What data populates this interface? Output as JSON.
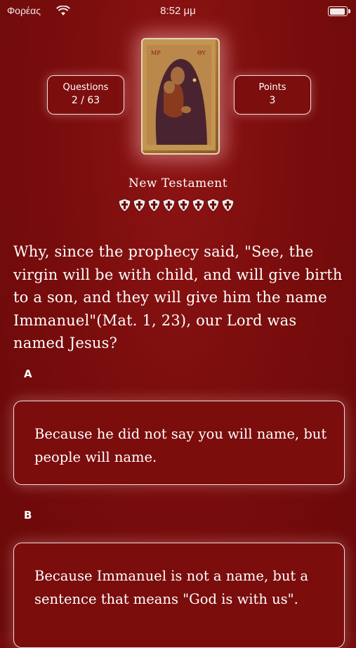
{
  "status_bar": {
    "carrier": "Φορέας",
    "time": "8:52 μμ"
  },
  "stats": {
    "questions_label": "Questions",
    "questions_value": "2 / 63",
    "points_label": "Points",
    "points_value": "3"
  },
  "category": "New Testament",
  "shields_count": 8,
  "question": "Why, since the prophecy said, \"See, the virgin will be with child, and will give birth to a son, and they will give him the name Immanuel\"(Mat. 1, 23), our Lord was named Jesus?",
  "answers": [
    {
      "letter": "A",
      "text": "Because he did not say you will name, but people will name."
    },
    {
      "letter": "B",
      "text": "Because Immanuel is not a name, but a sentence that means \"God is with us\"."
    }
  ],
  "colors": {
    "background": "#7a0d0d",
    "border": "#f2dcdc",
    "text": "#ffffff"
  }
}
